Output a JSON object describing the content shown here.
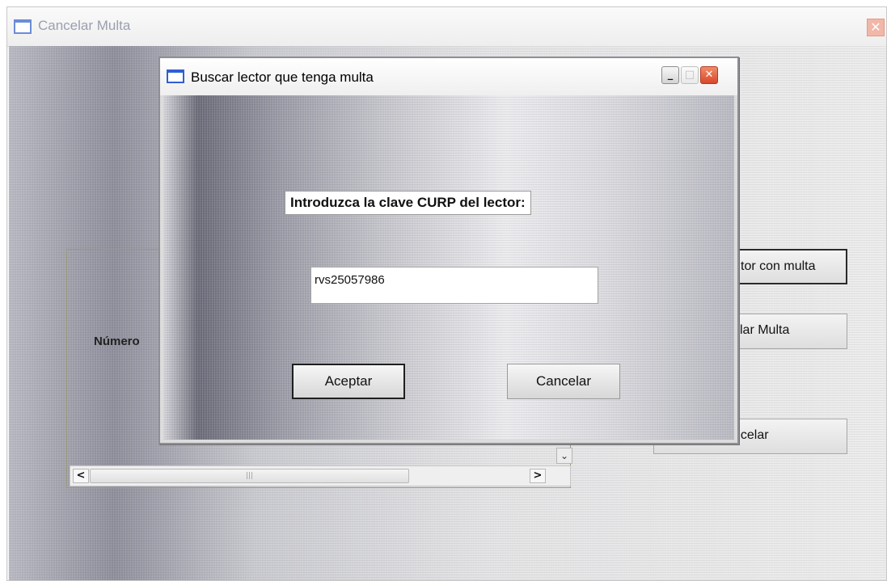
{
  "outer_window": {
    "title": "Cancelar Multa",
    "close_glyph": "✕"
  },
  "background": {
    "numero_label": "Número",
    "buttons": [
      {
        "label": "tor con multa"
      },
      {
        "label": "lar Multa"
      },
      {
        "label": "ncelar"
      }
    ],
    "scrollbar": {
      "left_glyph": "<",
      "right_glyph": ">",
      "thumb_glyph": "|||",
      "down_glyph": "⌄"
    }
  },
  "dialog": {
    "title": "Buscar lector que tenga multa",
    "min_glyph": "_",
    "max_glyph": "□",
    "close_glyph": "✕",
    "prompt": "Introduzca la clave CURP del lector:",
    "input_value": "rvs25057986",
    "accept_label": "Aceptar",
    "cancel_label": "Cancelar"
  },
  "icons": [
    "window-icon",
    "close-icon",
    "minimize-icon",
    "maximize-icon",
    "scroll-left-icon",
    "scroll-right-icon",
    "scroll-down-icon"
  ]
}
